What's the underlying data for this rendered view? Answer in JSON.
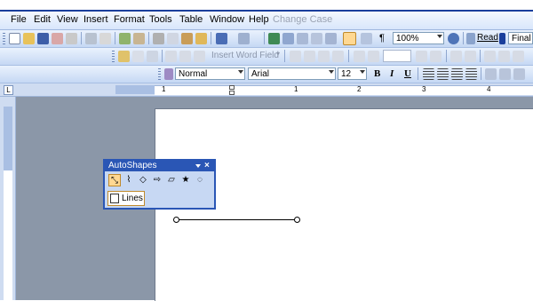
{
  "menu": {
    "items": [
      {
        "label": "File"
      },
      {
        "label": "Edit"
      },
      {
        "label": "View"
      },
      {
        "label": "Insert"
      },
      {
        "label": "Format"
      },
      {
        "label": "Tools"
      },
      {
        "label": "Table"
      },
      {
        "label": "Window"
      },
      {
        "label": "Help"
      },
      {
        "label": "Change Case"
      }
    ]
  },
  "toolbar_standard": {
    "zoom_value": "100%",
    "read_label": "Read",
    "view_mode_value": "Final"
  },
  "toolbar_fields": {
    "insert_word_field_label": "Insert Word Field"
  },
  "toolbar_formatting": {
    "style_value": "Normal",
    "font_value": "Arial",
    "size_value": "12",
    "bold_label": "B",
    "italic_label": "I",
    "underline_label": "U"
  },
  "ruler": {
    "numbers": [
      "1",
      "1",
      "2",
      "3",
      "4"
    ]
  },
  "autoshapes": {
    "title": "AutoShapes",
    "tools": [
      "lines-tool",
      "connectors-tool",
      "basic-shapes-tool",
      "block-arrows-tool",
      "flowchart-tool",
      "stars-banners-tool",
      "callouts-tool"
    ],
    "lines_label": "Lines"
  },
  "colors": {
    "accent": "#2a56b5",
    "workspace": "#8b97a8",
    "toolbar": "#c5d8f4"
  }
}
